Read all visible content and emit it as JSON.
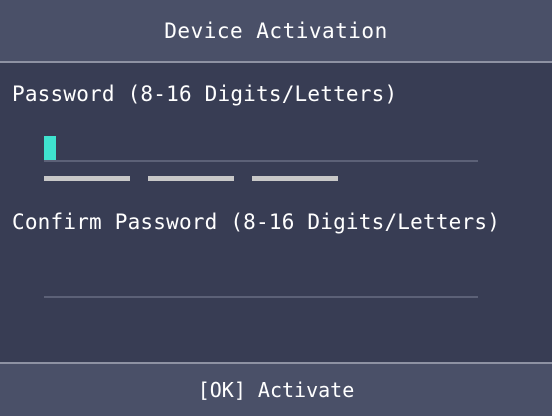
{
  "header": {
    "title": "Device Activation"
  },
  "password": {
    "label": "Password (8-16 Digits/Letters)",
    "value": "",
    "strength_segments": 3
  },
  "confirm_password": {
    "label": "Confirm Password (8-16 Digits/Letters)",
    "value": ""
  },
  "footer": {
    "action_label": "[OK] Activate"
  },
  "colors": {
    "background": "#383d54",
    "bar": "#4a5068",
    "cursor": "#3fe3cf",
    "strength": "#c8c8c8"
  }
}
